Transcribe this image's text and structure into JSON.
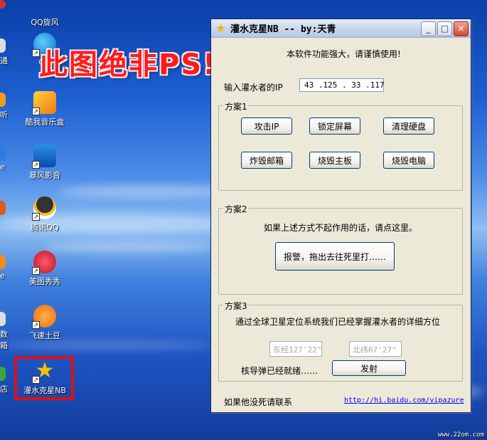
{
  "desktop": {
    "icons": [
      {
        "label": "QQ旋风",
        "icon": "qq-cyclone-icon"
      },
      {
        "label": "QQ",
        "icon": "qq-film-icon"
      },
      {
        "label": "酷我音乐盒",
        "icon": "kuwo-music-icon"
      },
      {
        "label": "暴风影音",
        "icon": "storm-player-icon"
      },
      {
        "label": "腾讯QQ",
        "icon": "qq-penguin-icon"
      },
      {
        "label": "美图秀秀",
        "icon": "meitu-icon"
      },
      {
        "label": "飞速土豆",
        "icon": "tudou-icon"
      },
      {
        "label": "灌水克星NB",
        "icon": "star-icon"
      }
    ],
    "edge_labels": [
      "通",
      "听",
      "e",
      "e",
      "数箱",
      "店"
    ],
    "overlay_text": "此图绝非PS!",
    "watermark": "www.22om.com"
  },
  "window": {
    "title": "灌水克星NB -- by:天青",
    "notice": "本软件功能强大，请谨慎使用!",
    "ip_label": "输入灌水者的IP",
    "ip_value": "43 .125 . 33 .117",
    "plan1": {
      "legend": "方案1",
      "buttons": [
        "攻击IP",
        "锁定屏幕",
        "清理硬盘",
        "炸毁邮箱",
        "烧毁主板",
        "烧毁电脑"
      ]
    },
    "plan2": {
      "legend": "方案2",
      "hint": "如果上述方式不起作用的话，请点这里。",
      "button": "报警，拖出去往死里打……"
    },
    "plan3": {
      "legend": "方案3",
      "hint": "通过全球卫星定位系统我们已经掌握灌水者的详细方位",
      "longitude": "东经127'22\"",
      "latitude": "北纬67'27\"",
      "status": "核导弹已经就绪……",
      "button": "发射"
    },
    "footer_text": "如果他没死请联系",
    "footer_link": "http://hi.baidu.com/vipazure"
  }
}
